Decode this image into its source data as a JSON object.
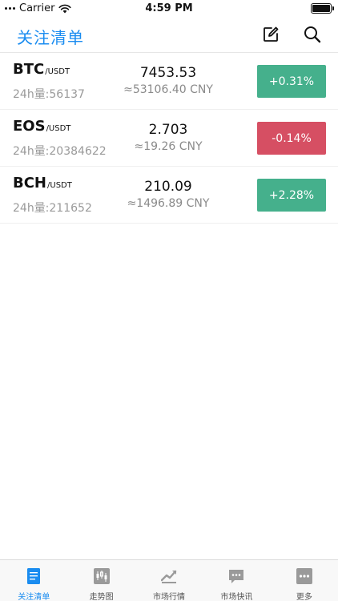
{
  "status_bar": {
    "carrier": "Carrier",
    "time": "4:59 PM",
    "battery_level": 1.0
  },
  "nav": {
    "title": "关注清单",
    "edit_icon": "edit-icon",
    "search_icon": "search-icon"
  },
  "watchlist": [
    {
      "symbol": "BTC",
      "quote": "/USDT",
      "volume": "24h量:56137",
      "price": "7453.53",
      "cny": "≈53106.40 CNY",
      "change": "+0.31%",
      "direction": "up"
    },
    {
      "symbol": "EOS",
      "quote": "/USDT",
      "volume": "24h量:20384622",
      "price": "2.703",
      "cny": "≈19.26 CNY",
      "change": "-0.14%",
      "direction": "down"
    },
    {
      "symbol": "BCH",
      "quote": "/USDT",
      "volume": "24h量:211652",
      "price": "210.09",
      "cny": "≈1496.89 CNY",
      "change": "+2.28%",
      "direction": "up"
    }
  ],
  "tabs": [
    {
      "label": "关注清单",
      "icon": "document-icon",
      "active": true
    },
    {
      "label": "走势图",
      "icon": "candlestick-icon",
      "active": false
    },
    {
      "label": "市场行情",
      "icon": "trend-chart-icon",
      "active": false
    },
    {
      "label": "市场快讯",
      "icon": "chat-bubble-icon",
      "active": false
    },
    {
      "label": "更多",
      "icon": "more-icon",
      "active": false
    }
  ],
  "colors": {
    "accent": "#1a8cf0",
    "up": "#45b08c",
    "down": "#d64f63",
    "tab_icon_inactive": "#9a9a9a"
  }
}
